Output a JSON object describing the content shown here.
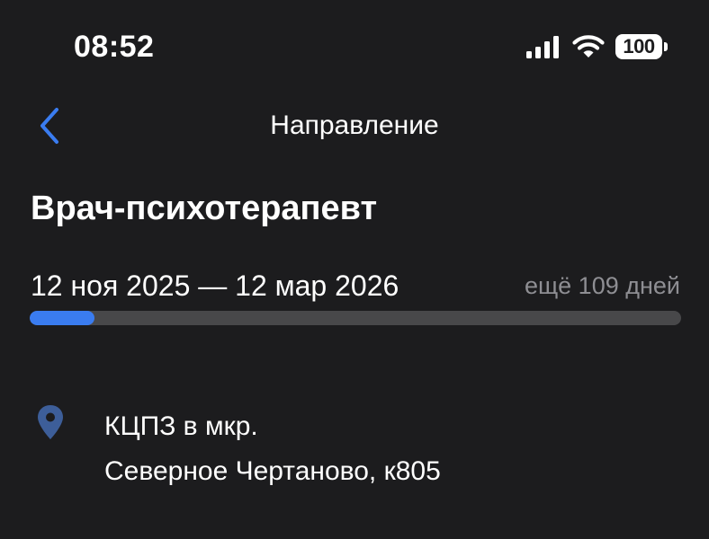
{
  "status_bar": {
    "time": "08:52",
    "battery": "100",
    "icons": [
      "signal-icon",
      "wifi-icon",
      "battery-icon"
    ]
  },
  "nav": {
    "back_icon": "chevron-left-icon",
    "title": "Направление"
  },
  "referral": {
    "title": "Врач-психотерапевт",
    "period": "12 ноя 2025 — 12 мар 2026",
    "remaining": "ещё 109 дней",
    "progress_fraction": 0.1
  },
  "location": {
    "icon": "map-pin-icon",
    "line1": "КЦПЗ в мкр.",
    "line2": "Северное Чертаново, к805"
  },
  "colors": {
    "background": "#1c1c1e",
    "accent": "#3a7cf0",
    "track": "#48484a",
    "secondary_text": "#8e8e93",
    "pin": "#3d5e99"
  }
}
